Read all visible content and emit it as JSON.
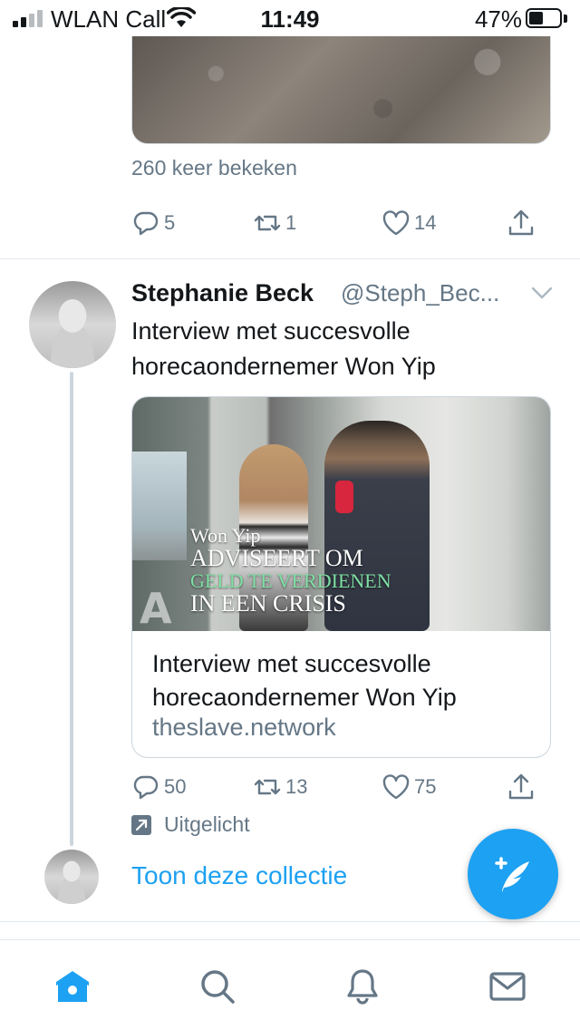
{
  "status_bar": {
    "carrier": "WLAN Call",
    "time": "11:49",
    "battery_percent": "47%",
    "battery_level": 0.47
  },
  "prev_tweet": {
    "views": "260 keer bekeken",
    "actions": {
      "replies": "5",
      "retweets": "1",
      "likes": "14"
    }
  },
  "tweet": {
    "name": "Stephanie Beck",
    "handle": "@Steph_Bec...",
    "text": "Interview met succesvolle horecaondernemer Won Yip",
    "card": {
      "media_caption": {
        "line1": "Won Yip",
        "line2": "ADVISEERT OM",
        "line3": "GELD TE VERDIENEN",
        "line4": "IN EEN CRISIS",
        "logo": "A"
      },
      "title": "Interview met succesvolle horecaondernemer Won Yip",
      "domain": "theslave.network"
    },
    "actions": {
      "replies": "50",
      "retweets": "13",
      "likes": "75"
    },
    "featured_label": "Uitgelicht"
  },
  "collection_link": "Toon deze collectie",
  "tabbar": {
    "tabs": [
      "home-icon",
      "search-icon",
      "notifications-icon",
      "messages-icon"
    ],
    "active_color": "#1da1f2"
  },
  "colors": {
    "accent": "#1da1f2",
    "secondary_text": "#657786"
  }
}
